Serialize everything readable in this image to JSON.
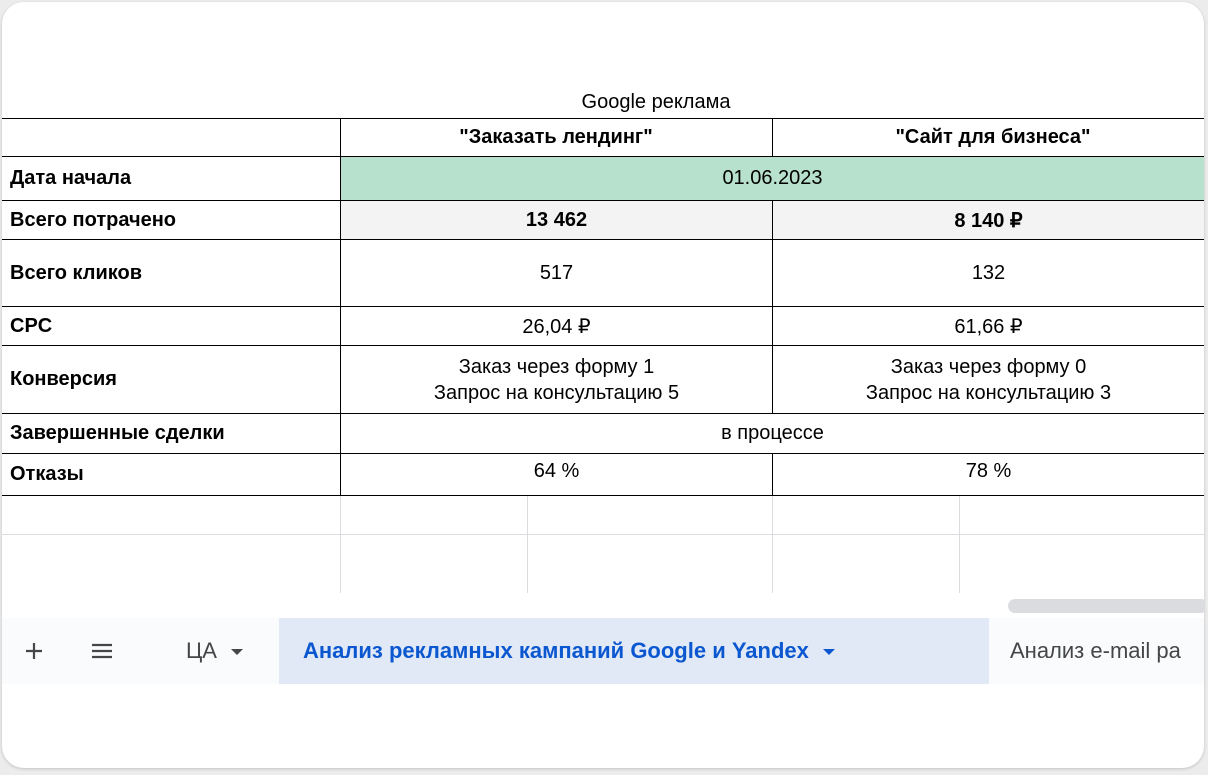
{
  "sheet": {
    "title": "Google реклама",
    "columns": [
      "\"Заказать лендинг\"",
      "\"Сайт для бизнеса\""
    ],
    "rows": {
      "start_date": {
        "label": "Дата начала",
        "value": "01.06.2023"
      },
      "spent": {
        "label": "Всего потрачено",
        "values": [
          "13 462",
          "8 140 ₽"
        ]
      },
      "clicks": {
        "label": "Всего кликов",
        "values": [
          "517",
          "132"
        ]
      },
      "cpc": {
        "label": "CPC",
        "values": [
          "26,04 ₽",
          "61,66 ₽"
        ]
      },
      "conversion": {
        "label": "Конверсия",
        "values": [
          [
            "Заказ через форму 1",
            "Запрос на консультацию 5"
          ],
          [
            "Заказ через форму 0",
            "Запрос на консультацию 3"
          ]
        ]
      },
      "deals": {
        "label": "Завершенные сделки",
        "value": "в процессе"
      },
      "bounces": {
        "label": "Отказы",
        "values": [
          "64 %",
          "78 %"
        ]
      }
    },
    "colors": {
      "start_date_bg": "#b7e1cd",
      "spent_bg": "#f3f3f3",
      "active_tab_bg": "#e1e9f7",
      "active_tab_text": "#0b57d0"
    }
  },
  "tabbar": {
    "add_icon": "plus-icon",
    "menu_icon": "hamburger-menu-icon",
    "tabs": [
      {
        "label": "ЦА",
        "active": false
      },
      {
        "label": "Анализ рекламных кампаний Google и Yandex",
        "active": true
      },
      {
        "label": "Анализ e-mail ра",
        "active": false
      }
    ]
  }
}
